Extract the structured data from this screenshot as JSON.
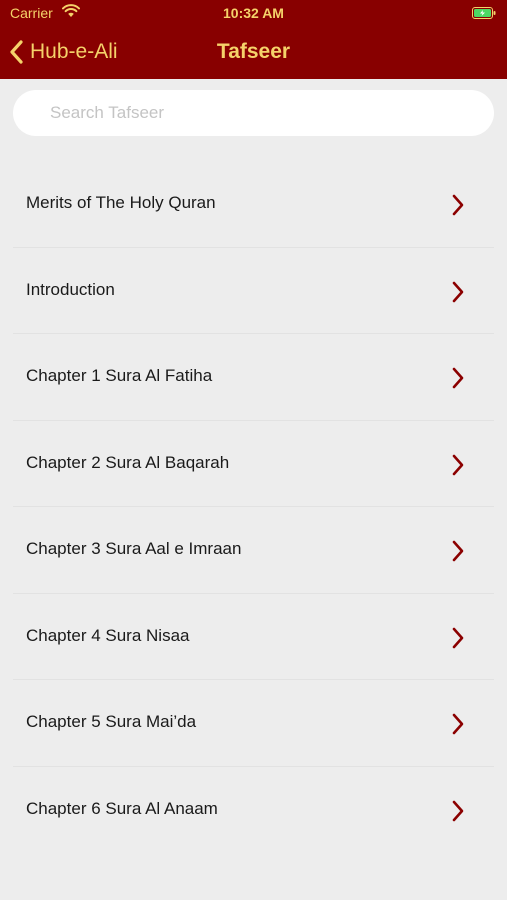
{
  "status_bar": {
    "carrier": "Carrier",
    "time": "10:32 AM"
  },
  "nav": {
    "back_label": "Hub-e-Ali",
    "title": "Tafseer"
  },
  "search": {
    "placeholder": "Search Tafseer"
  },
  "colors": {
    "header_background": "#880000",
    "header_text": "#f5d26a",
    "chevron": "#8b0000",
    "page_background": "#ededed"
  },
  "icons": {
    "back": "chevron-left-icon",
    "row": "chevron-right-icon",
    "wifi": "wifi-icon",
    "battery": "battery-icon"
  },
  "items": [
    {
      "label": "Merits of The Holy Quran"
    },
    {
      "label": "Introduction"
    },
    {
      "label": "Chapter 1 Sura Al Fatiha"
    },
    {
      "label": "Chapter 2 Sura Al Baqarah"
    },
    {
      "label": "Chapter 3 Sura Aal e Imraan"
    },
    {
      "label": "Chapter 4 Sura Nisaa"
    },
    {
      "label": "Chapter 5 Sura Mai’da"
    },
    {
      "label": "Chapter 6 Sura Al Anaam"
    }
  ]
}
